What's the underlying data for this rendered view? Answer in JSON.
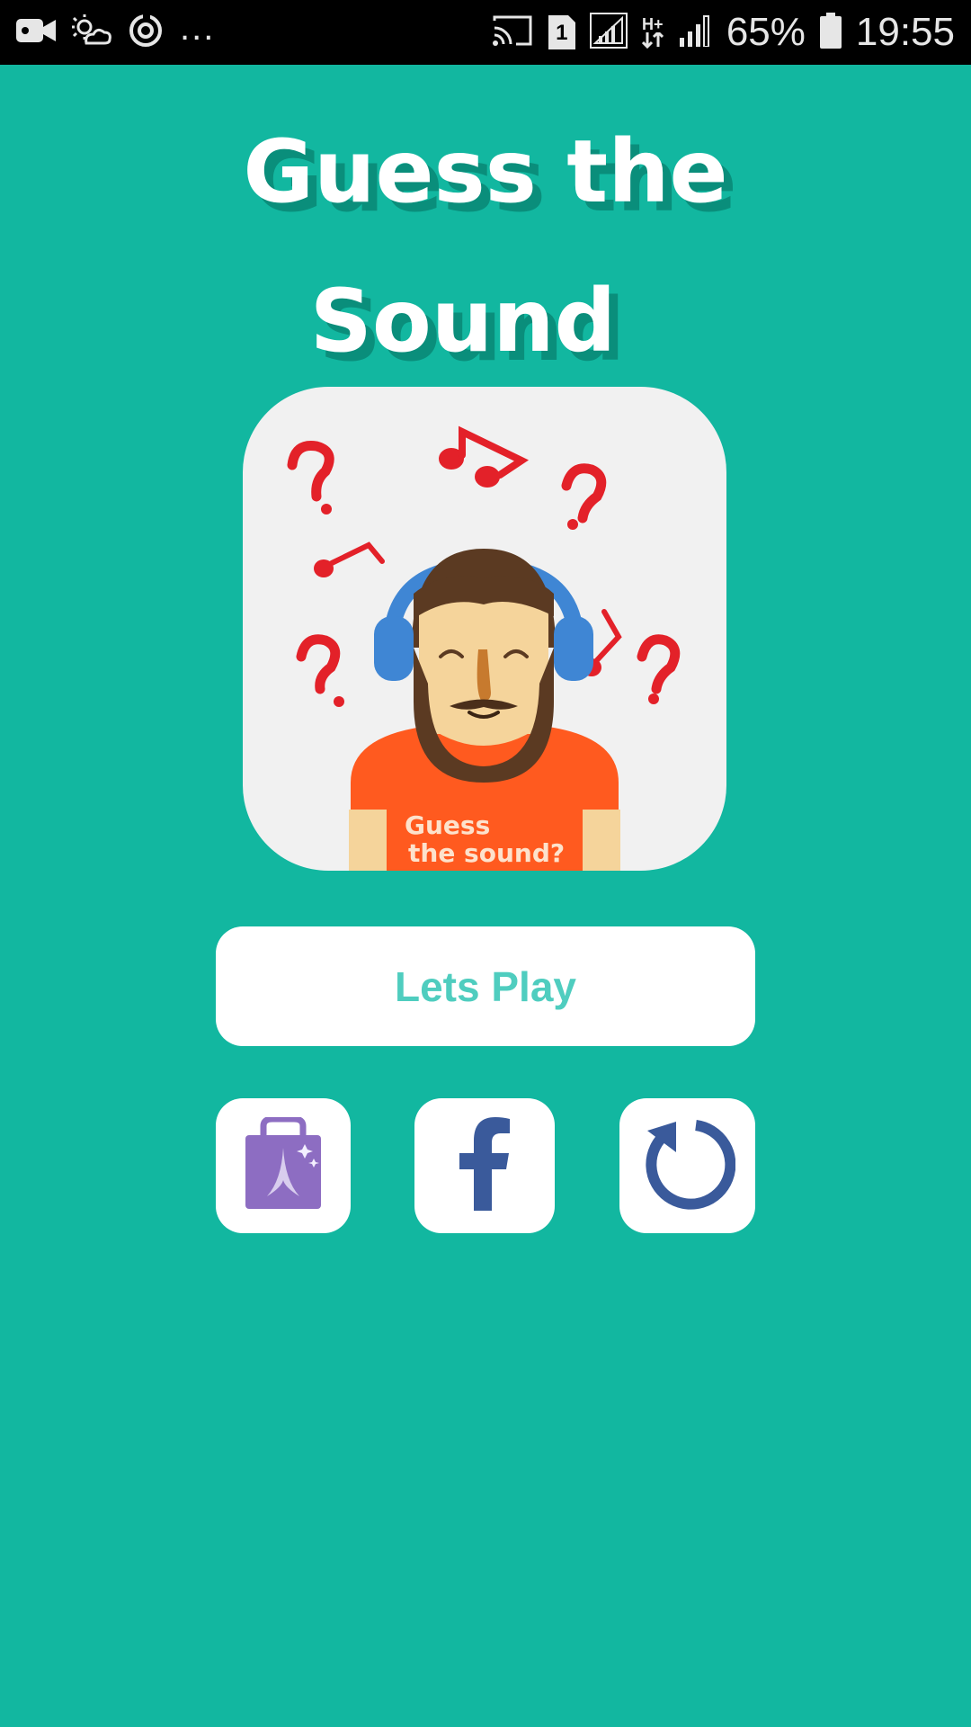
{
  "status_bar": {
    "battery_percent": "65%",
    "time": "19:55",
    "more_indicator": "...",
    "sim_slot": "1",
    "network_type": "H+",
    "icons": [
      "video-camera-icon",
      "weather-icon",
      "sync-icon",
      "cast-icon",
      "sim-card-icon",
      "signal-icon",
      "data-transfer-icon",
      "signal-icon",
      "battery-icon"
    ]
  },
  "app": {
    "title_line1": "Guess the",
    "title_line2": "Sound",
    "logo_shirt_line1": "Guess",
    "logo_shirt_line2": "the sound?"
  },
  "actions": {
    "play_label": "Lets Play",
    "icons": [
      "shop-bag-icon",
      "facebook-icon",
      "refresh-icon"
    ]
  },
  "colors": {
    "background": "#12b7a0",
    "play_text": "#4fcdbf",
    "icon_blue": "#3a5a9b",
    "shop_purple": "#8d6dc2",
    "notes_red": "#e32129",
    "shirt_orange": "#ff5a1f"
  }
}
